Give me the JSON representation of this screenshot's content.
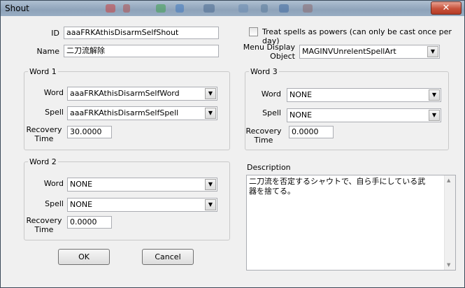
{
  "window": {
    "title": "Shout",
    "close_glyph": "✕"
  },
  "form": {
    "id_label": "ID",
    "id_value": "aaaFRKAthisDisarmSelfShout",
    "name_label": "Name",
    "name_value": "二刀流解除",
    "treat_spells_label": "Treat spells as powers (can only be cast once per day)",
    "treat_spells_checked": false,
    "menu_display_label_1": "Menu Display",
    "menu_display_label_2": "Object",
    "menu_display_value": "MAGINVUnrelentSpellArt"
  },
  "word_groups": [
    {
      "title": "Word 1",
      "word_label": "Word",
      "word_value": "aaaFRKAthisDisarmSelfWord",
      "spell_label": "Spell",
      "spell_value": "aaaFRKAthisDisarmSelfSpell",
      "recovery_label_1": "Recovery",
      "recovery_label_2": "Time",
      "recovery_value": "30.0000"
    },
    {
      "title": "Word 2",
      "word_label": "Word",
      "word_value": "NONE",
      "spell_label": "Spell",
      "spell_value": "NONE",
      "recovery_label_1": "Recovery",
      "recovery_label_2": "Time",
      "recovery_value": "0.0000"
    },
    {
      "title": "Word 3",
      "word_label": "Word",
      "word_value": "NONE",
      "spell_label": "Spell",
      "spell_value": "NONE",
      "recovery_label_1": "Recovery",
      "recovery_label_2": "Time",
      "recovery_value": "0.0000"
    }
  ],
  "description": {
    "label": "Description",
    "text": "二刀流を否定するシャウトで、自ら手にしている武器を捨てる。"
  },
  "buttons": {
    "ok": "OK",
    "cancel": "Cancel"
  },
  "icons": {
    "dropdown": "chevron-down-icon",
    "close": "close-icon",
    "scroll_up": "scroll-up-icon",
    "scroll_down": "scroll-down-icon"
  }
}
